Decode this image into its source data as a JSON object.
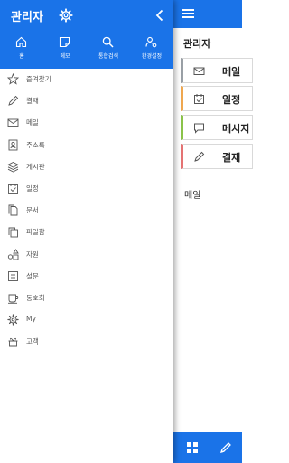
{
  "app": {
    "title": "관리자",
    "cards": [
      {
        "label": "메일",
        "icon": "mail-icon"
      },
      {
        "label": "일정",
        "icon": "calendar-icon"
      },
      {
        "label": "메시지",
        "icon": "message-icon"
      },
      {
        "label": "결재",
        "icon": "pen-icon"
      }
    ],
    "section_label": "메일",
    "colors": {
      "brand": "#1a73e8"
    }
  },
  "drawer": {
    "title": "관리자",
    "quick": [
      {
        "label": "홈",
        "icon": "home-icon"
      },
      {
        "label": "메모",
        "icon": "memo-icon"
      },
      {
        "label": "통합검색",
        "icon": "search-icon"
      },
      {
        "label": "환경설정",
        "icon": "user-settings-icon"
      }
    ],
    "menu": [
      {
        "label": "즐겨찾기",
        "icon": "star-icon"
      },
      {
        "label": "결재",
        "icon": "pen-icon"
      },
      {
        "label": "메일",
        "icon": "mail-icon"
      },
      {
        "label": "주소록",
        "icon": "contact-icon"
      },
      {
        "label": "게시판",
        "icon": "layers-icon"
      },
      {
        "label": "일정",
        "icon": "calendar-icon"
      },
      {
        "label": "문서",
        "icon": "document-icon"
      },
      {
        "label": "파일함",
        "icon": "files-icon"
      },
      {
        "label": "자원",
        "icon": "resource-icon"
      },
      {
        "label": "설문",
        "icon": "survey-icon"
      },
      {
        "label": "동호회",
        "icon": "coffee-icon"
      },
      {
        "label": "My",
        "icon": "gear-icon"
      },
      {
        "label": "고객",
        "icon": "gift-icon"
      }
    ]
  }
}
